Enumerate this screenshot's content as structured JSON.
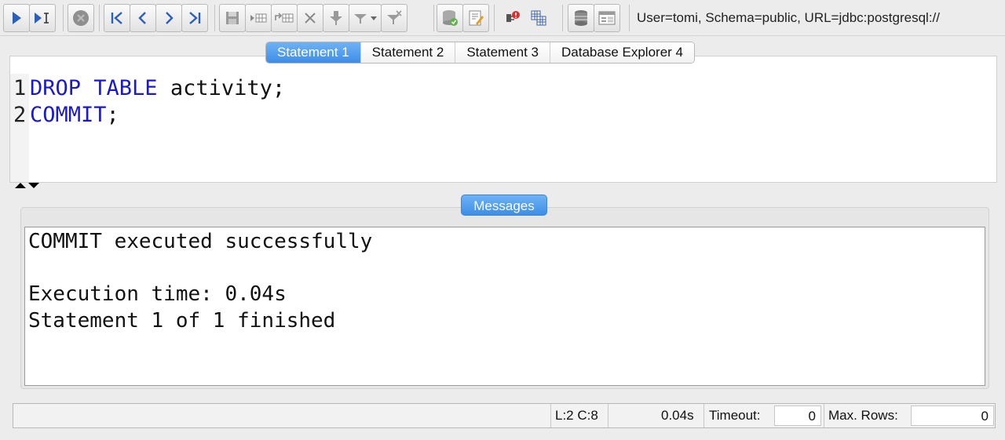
{
  "toolbar": {
    "buttons": [
      {
        "name": "run-statement-icon"
      },
      {
        "name": "run-step-icon"
      },
      {
        "name": "stop-icon"
      },
      {
        "name": "first-icon"
      },
      {
        "name": "previous-icon"
      },
      {
        "name": "next-icon"
      },
      {
        "name": "last-icon"
      },
      {
        "name": "save-icon"
      },
      {
        "name": "insert-row-icon"
      },
      {
        "name": "duplicate-row-icon"
      },
      {
        "name": "delete-icon"
      },
      {
        "name": "filter-icon"
      },
      {
        "name": "filter-dropdown-icon"
      },
      {
        "name": "clear-filter-icon"
      },
      {
        "name": "database-check-icon"
      },
      {
        "name": "database-edit-icon"
      },
      {
        "name": "cancel-connection-icon"
      },
      {
        "name": "grid-icon"
      },
      {
        "name": "table-icon"
      },
      {
        "name": "form-icon"
      }
    ],
    "connection_info": "User=tomi, Schema=public, URL=jdbc:postgresql://"
  },
  "tabs": [
    {
      "label": "Statement 1",
      "active": true
    },
    {
      "label": "Statement 2",
      "active": false
    },
    {
      "label": "Statement 3",
      "active": false
    },
    {
      "label": "Database Explorer 4",
      "active": false
    }
  ],
  "editor": {
    "lines": [
      {
        "number": "1",
        "keyword": "DROP TABLE",
        "rest": " activity;"
      },
      {
        "number": "2",
        "keyword": "COMMIT",
        "rest": ";"
      }
    ]
  },
  "messages": {
    "tab_label": "Messages",
    "lines": [
      "COMMIT executed successfully",
      "",
      "Execution time: 0.04s",
      "Statement 1 of 1 finished"
    ]
  },
  "status": {
    "cursor": "L:2 C:8",
    "time": "0.04s",
    "timeout_label": "Timeout:",
    "timeout_value": "0",
    "max_rows_label": "Max. Rows:",
    "max_rows_value": "0"
  },
  "colors": {
    "keyword": "#1a1acc",
    "active_tab": "#3d8ee8"
  }
}
